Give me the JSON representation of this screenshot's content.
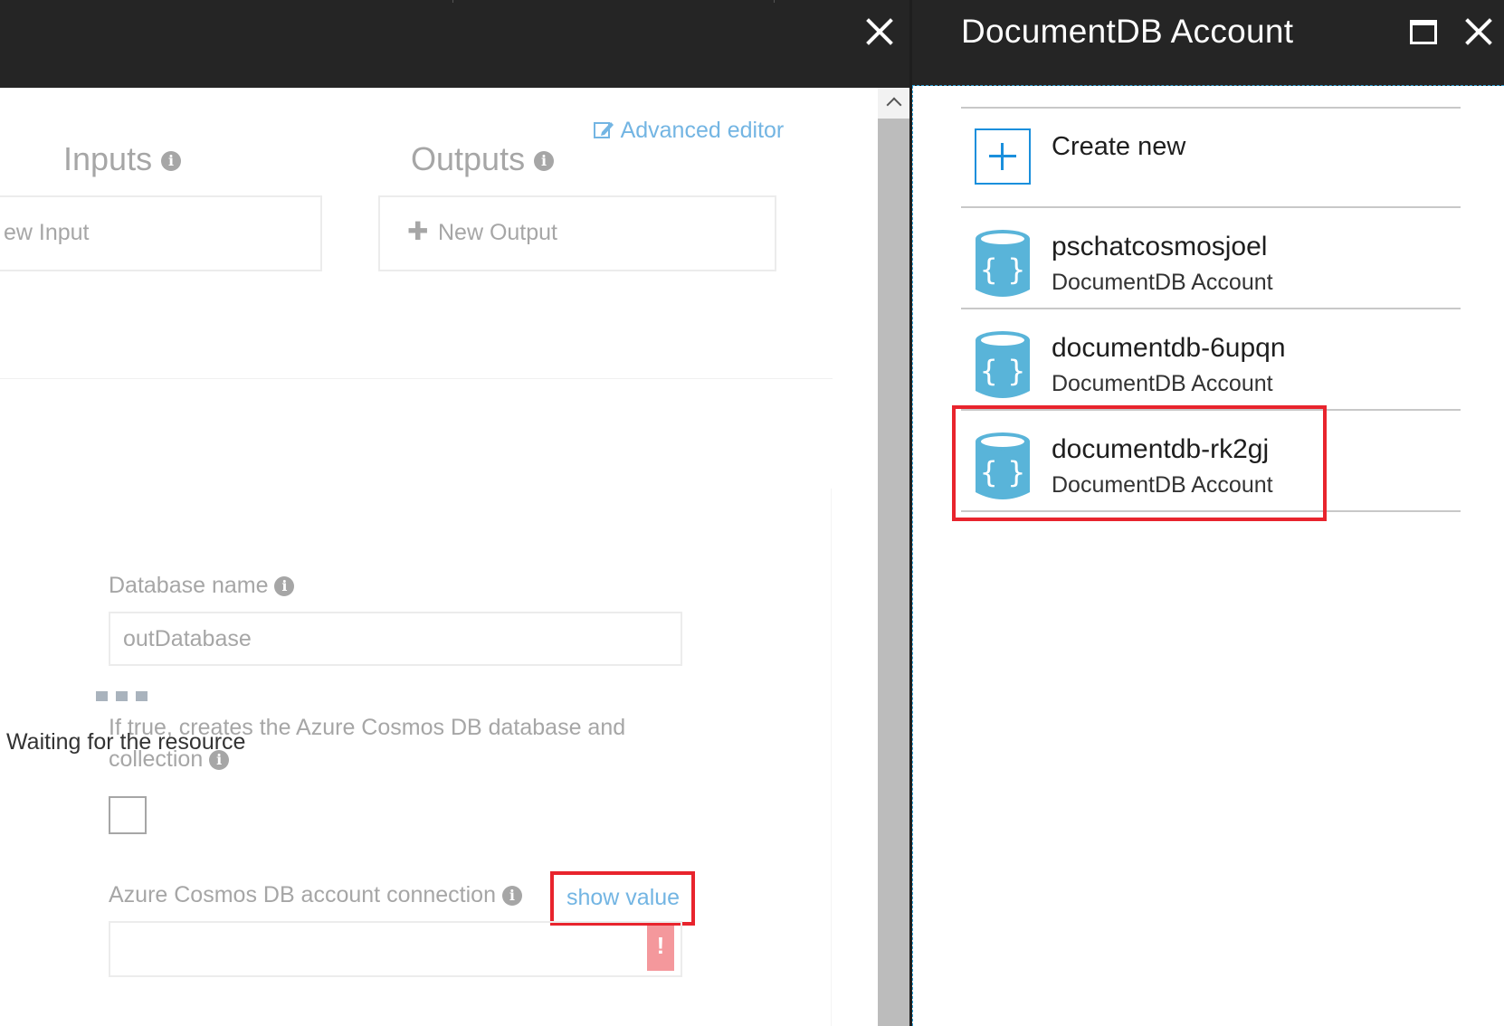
{
  "right_panel": {
    "title": "DocumentDB Account",
    "create_new_label": "Create new",
    "accounts": [
      {
        "name": "pschatcosmosjoel",
        "type": "DocumentDB Account"
      },
      {
        "name": "documentdb-6upqn",
        "type": "DocumentDB Account"
      },
      {
        "name": "documentdb-rk2gj",
        "type": "DocumentDB Account"
      }
    ]
  },
  "left_panel": {
    "inputs_heading": "Inputs",
    "outputs_heading": "Outputs",
    "advanced_editor": "Advanced editor",
    "new_input": "ew Input",
    "new_output": "New Output",
    "database_name_label": "Database name",
    "database_name_value": "outDatabase",
    "waiting_text": "Waiting for the resource",
    "create_if_not_exists_label": "If true, creates the Azure Cosmos DB database and collection",
    "connection_label": "Azure Cosmos DB account connection",
    "show_value": "show value",
    "error_badge": "!"
  },
  "colors": {
    "titlebar": "#252525",
    "accent": "#1a8fdc",
    "link": "#73b5e3",
    "highlight": "#e8242d",
    "db_icon": "#59b4d9"
  }
}
